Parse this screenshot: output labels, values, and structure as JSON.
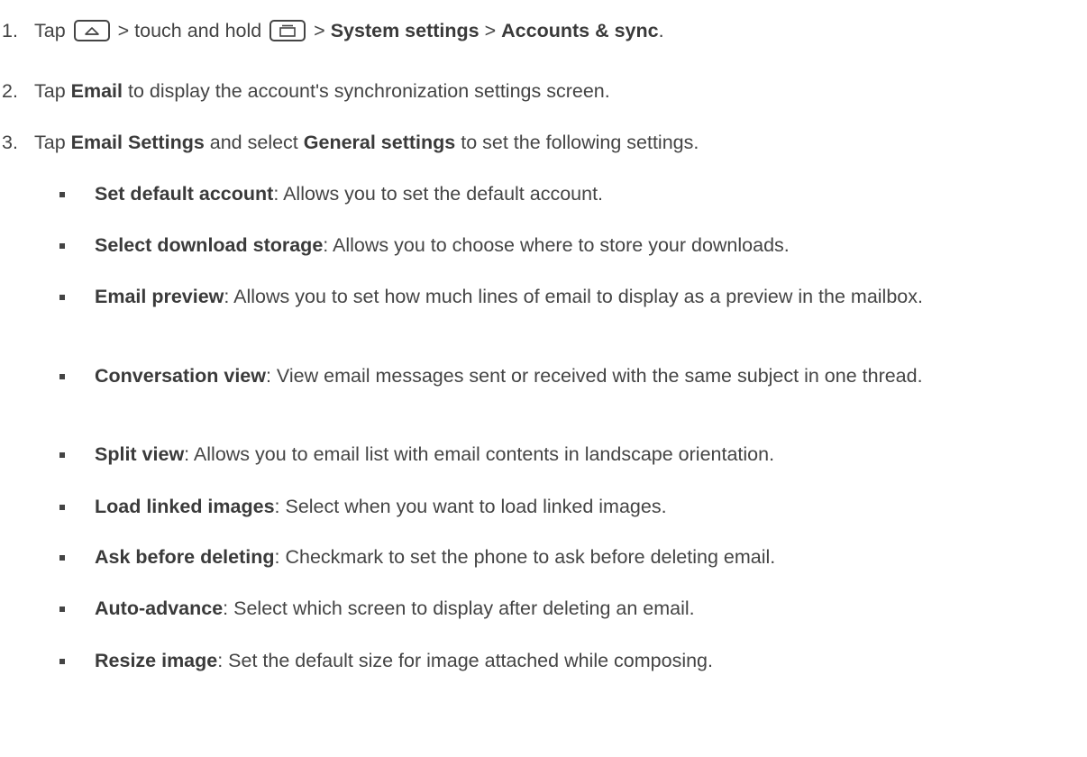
{
  "steps": [
    {
      "num": "1.",
      "t1": "Tap",
      "t2": " > touch and hold ",
      "t3": " > ",
      "b1": "System settings",
      "t4": " > ",
      "b2": "Accounts & sync",
      "t5": ".",
      "icon1": "home-key-icon",
      "icon2": "recent-apps-key-icon"
    },
    {
      "num": "2.",
      "t1": "Tap ",
      "b1": "Email",
      "t2": " to display the account's synchronization settings screen."
    },
    {
      "num": "3.",
      "t1": "Tap ",
      "b1": "Email Settings",
      "t2": " and select ",
      "b2": "General settings",
      "t3": " to set the following settings."
    }
  ],
  "items": [
    {
      "term": "Set default account",
      "desc": ": Allows you to set the default account."
    },
    {
      "term": "Select download storage",
      "desc": ": Allows you to choose where to store your downloads."
    },
    {
      "term": "Email preview",
      "desc": ": Allows you to set how much lines of email to display as a preview in the mailbox."
    },
    {
      "term": "Conversation view",
      "desc": ": View email messages sent or received with the same subject in one thread."
    },
    {
      "term": "Split view",
      "desc": ": Allows you to email list with email contents in landscape orientation."
    },
    {
      "term": "Load linked images",
      "desc": ": Select when you want to load linked images."
    },
    {
      "term": "Ask before deleting",
      "desc": ": Checkmark to set the phone to ask before deleting email."
    },
    {
      "term": "Auto-advance",
      "desc": ": Select which screen to display after deleting an email."
    },
    {
      "term": "Resize image",
      "desc": ": Set the default size for image attached while composing."
    }
  ]
}
